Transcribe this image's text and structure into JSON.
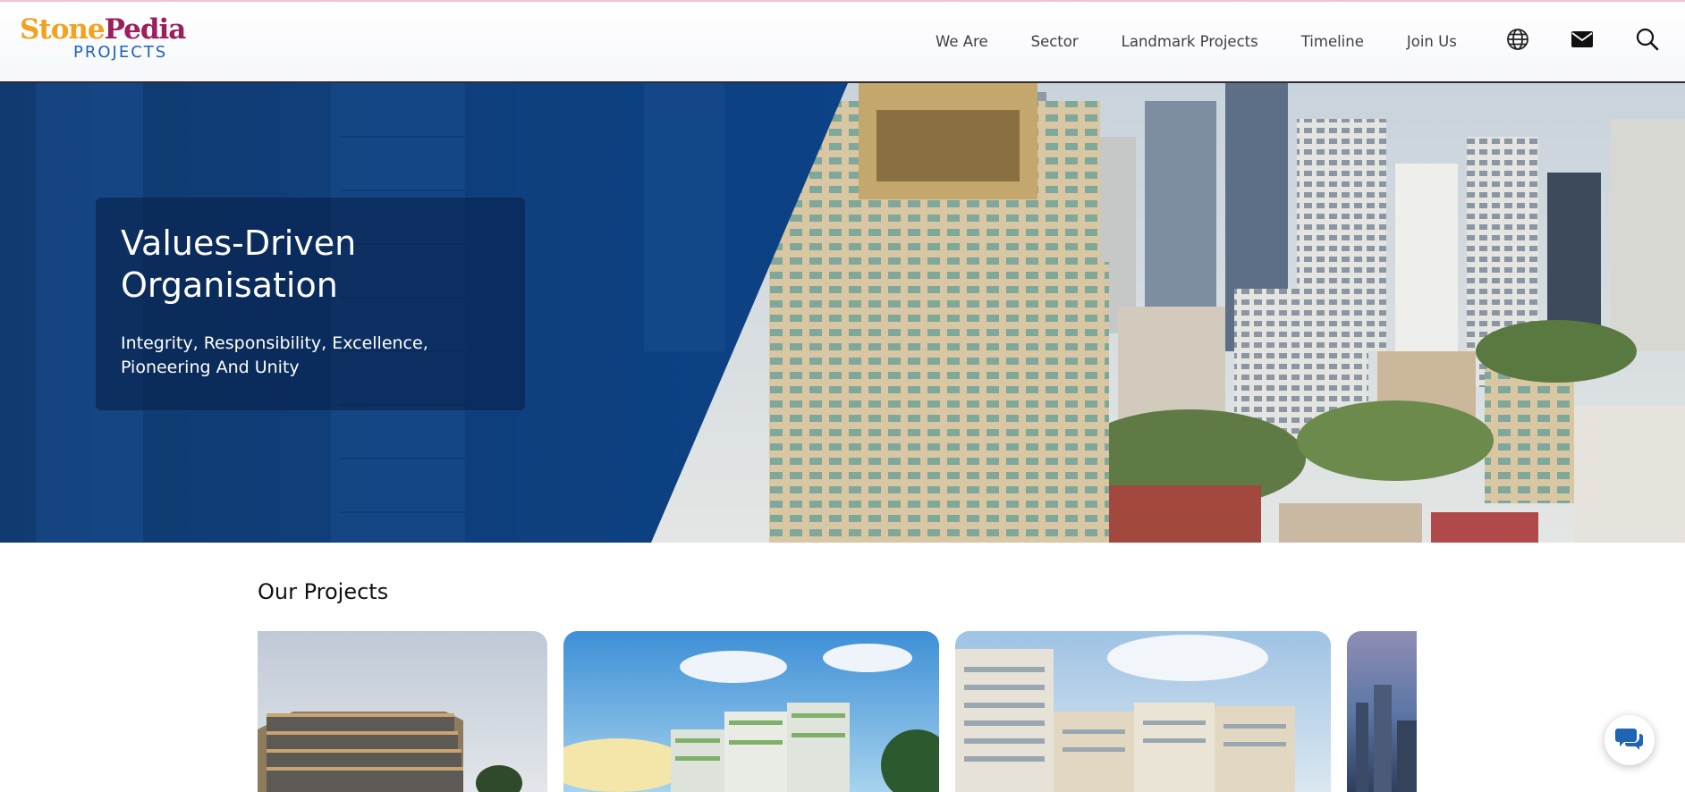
{
  "brand": {
    "name_part1": "Stone",
    "name_part2": "Pedia",
    "tagline": "PROJECTS"
  },
  "nav": {
    "items": [
      "We Are",
      "Sector",
      "Landmark Projects",
      "Timeline",
      "Join Us"
    ],
    "icons": [
      "globe-icon",
      "mail-icon",
      "search-icon"
    ]
  },
  "hero": {
    "title": "Values-Driven Organisation",
    "subtitle": "Integrity, Responsibility, Excellence, Pioneering And Unity"
  },
  "projects": {
    "heading": "Our Projects"
  },
  "colors": {
    "hero_blue": "#0d3f7f",
    "accent": "#1f64b5",
    "brand_orange": "#f2a21d",
    "brand_magenta": "#9c1f5c"
  }
}
